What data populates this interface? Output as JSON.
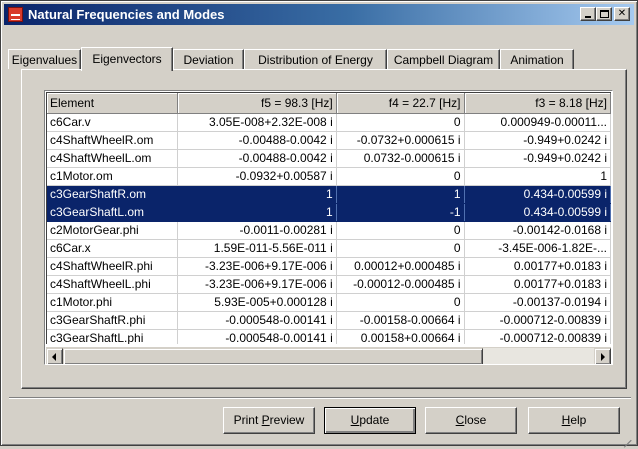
{
  "window": {
    "title": "Natural Frequencies and Modes"
  },
  "tabs": [
    {
      "label": "Eigenvalues",
      "active": false
    },
    {
      "label": "Eigenvectors",
      "active": true
    },
    {
      "label": "Deviation",
      "active": false
    },
    {
      "label": "Distribution of Energy",
      "active": false
    },
    {
      "label": "Campbell Diagram",
      "active": false
    },
    {
      "label": "Animation",
      "active": false
    }
  ],
  "table": {
    "columns": [
      "Element",
      "f5 = 98.3 [Hz]",
      "f4 = 22.7 [Hz]",
      "f3 = 8.18 [Hz]"
    ],
    "rows": [
      {
        "cells": [
          "c6Car.v",
          "3.05E-008+2.32E-008 i",
          "0",
          "0.000949-0.00011..."
        ],
        "selected": false
      },
      {
        "cells": [
          "c4ShaftWheelR.om",
          "-0.00488-0.0042 i",
          "-0.0732+0.000615 i",
          "-0.949+0.0242 i"
        ],
        "selected": false
      },
      {
        "cells": [
          "c4ShaftWheelL.om",
          "-0.00488-0.0042 i",
          "0.0732-0.000615 i",
          "-0.949+0.0242 i"
        ],
        "selected": false
      },
      {
        "cells": [
          "c1Motor.om",
          "-0.0932+0.00587 i",
          "0",
          "1"
        ],
        "selected": false
      },
      {
        "cells": [
          "c3GearShaftR.om",
          "1",
          "1",
          "0.434-0.00599 i"
        ],
        "selected": true
      },
      {
        "cells": [
          "c3GearShaftL.om",
          "1",
          "-1",
          "0.434-0.00599 i"
        ],
        "selected": true
      },
      {
        "cells": [
          "c2MotorGear.phi",
          "-0.0011-0.00281 i",
          "0",
          "-0.00142-0.0168 i"
        ],
        "selected": false
      },
      {
        "cells": [
          "c6Car.x",
          "1.59E-011-5.56E-011 i",
          "0",
          "-3.45E-006-1.82E-..."
        ],
        "selected": false
      },
      {
        "cells": [
          "c4ShaftWheelR.phi",
          "-3.23E-006+9.17E-006 i",
          "0.00012+0.000485 i",
          "0.00177+0.0183 i"
        ],
        "selected": false
      },
      {
        "cells": [
          "c4ShaftWheelL.phi",
          "-3.23E-006+9.17E-006 i",
          "-0.00012-0.000485 i",
          "0.00177+0.0183 i"
        ],
        "selected": false
      },
      {
        "cells": [
          "c1Motor.phi",
          "5.93E-005+0.000128 i",
          "0",
          "-0.00137-0.0194 i"
        ],
        "selected": false
      },
      {
        "cells": [
          "c3GearShaftR.phi",
          "-0.000548-0.00141 i",
          "-0.00158-0.00664 i",
          "-0.000712-0.00839 i"
        ],
        "selected": false
      },
      {
        "cells": [
          "c3GearShaftL.phi",
          "-0.000548-0.00141 i",
          "0.00158+0.00664 i",
          "-0.000712-0.00839 i"
        ],
        "selected": false
      }
    ]
  },
  "scrollbar": {
    "position": 0
  },
  "buttons": {
    "print_preview": {
      "pre": "Print ",
      "ul": "P",
      "post": "review"
    },
    "update": {
      "pre": "",
      "ul": "U",
      "post": "pdate"
    },
    "close": {
      "pre": "",
      "ul": "C",
      "post": "lose"
    },
    "help": {
      "pre": "",
      "ul": "H",
      "post": "elp"
    }
  },
  "colors": {
    "selection": "#0a246a",
    "title_start": "#0a246a",
    "title_end": "#a6caf0",
    "face": "#d4d0c8"
  }
}
